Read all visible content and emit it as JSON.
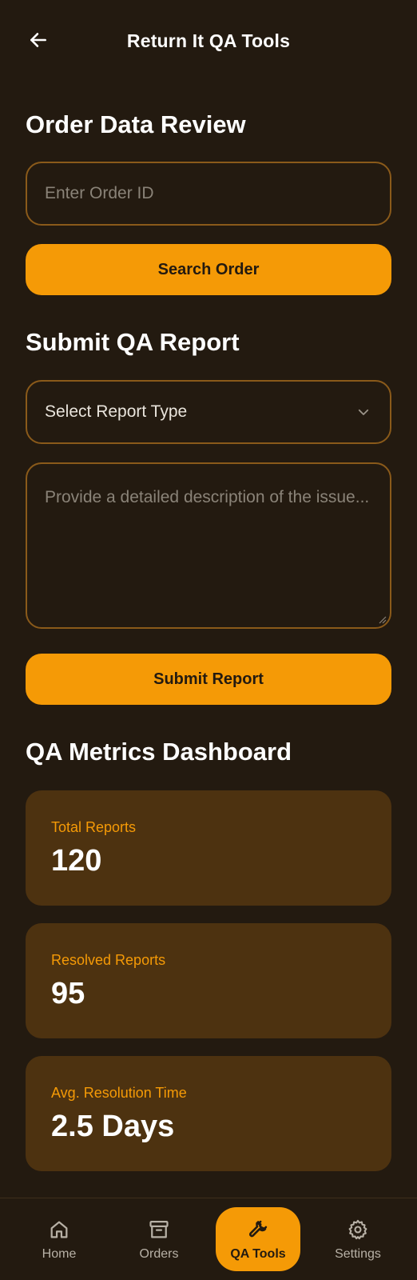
{
  "header": {
    "title": "Return It QA Tools",
    "back_icon": "arrow-left-icon"
  },
  "order_review": {
    "title": "Order Data Review",
    "order_id_placeholder": "Enter Order ID",
    "search_button": "Search Order"
  },
  "qa_report": {
    "title": "Submit QA Report",
    "report_type_selected": "Select Report Type",
    "description_placeholder": "Provide a detailed description of the issue...",
    "submit_button": "Submit Report"
  },
  "metrics": {
    "title": "QA Metrics Dashboard",
    "cards": [
      {
        "label": "Total Reports",
        "value": "120"
      },
      {
        "label": "Resolved Reports",
        "value": "95"
      },
      {
        "label": "Avg. Resolution Time",
        "value": "2.5 Days"
      }
    ]
  },
  "nav": {
    "items": [
      {
        "label": "Home",
        "icon": "home-icon"
      },
      {
        "label": "Orders",
        "icon": "archive-box-icon"
      },
      {
        "label": "QA Tools",
        "icon": "wrench-icon",
        "active": true
      },
      {
        "label": "Settings",
        "icon": "gear-icon"
      }
    ]
  },
  "colors": {
    "background": "#231a10",
    "accent": "#f59a06",
    "card": "#4d3210",
    "input_border": "#8a5a1a"
  }
}
